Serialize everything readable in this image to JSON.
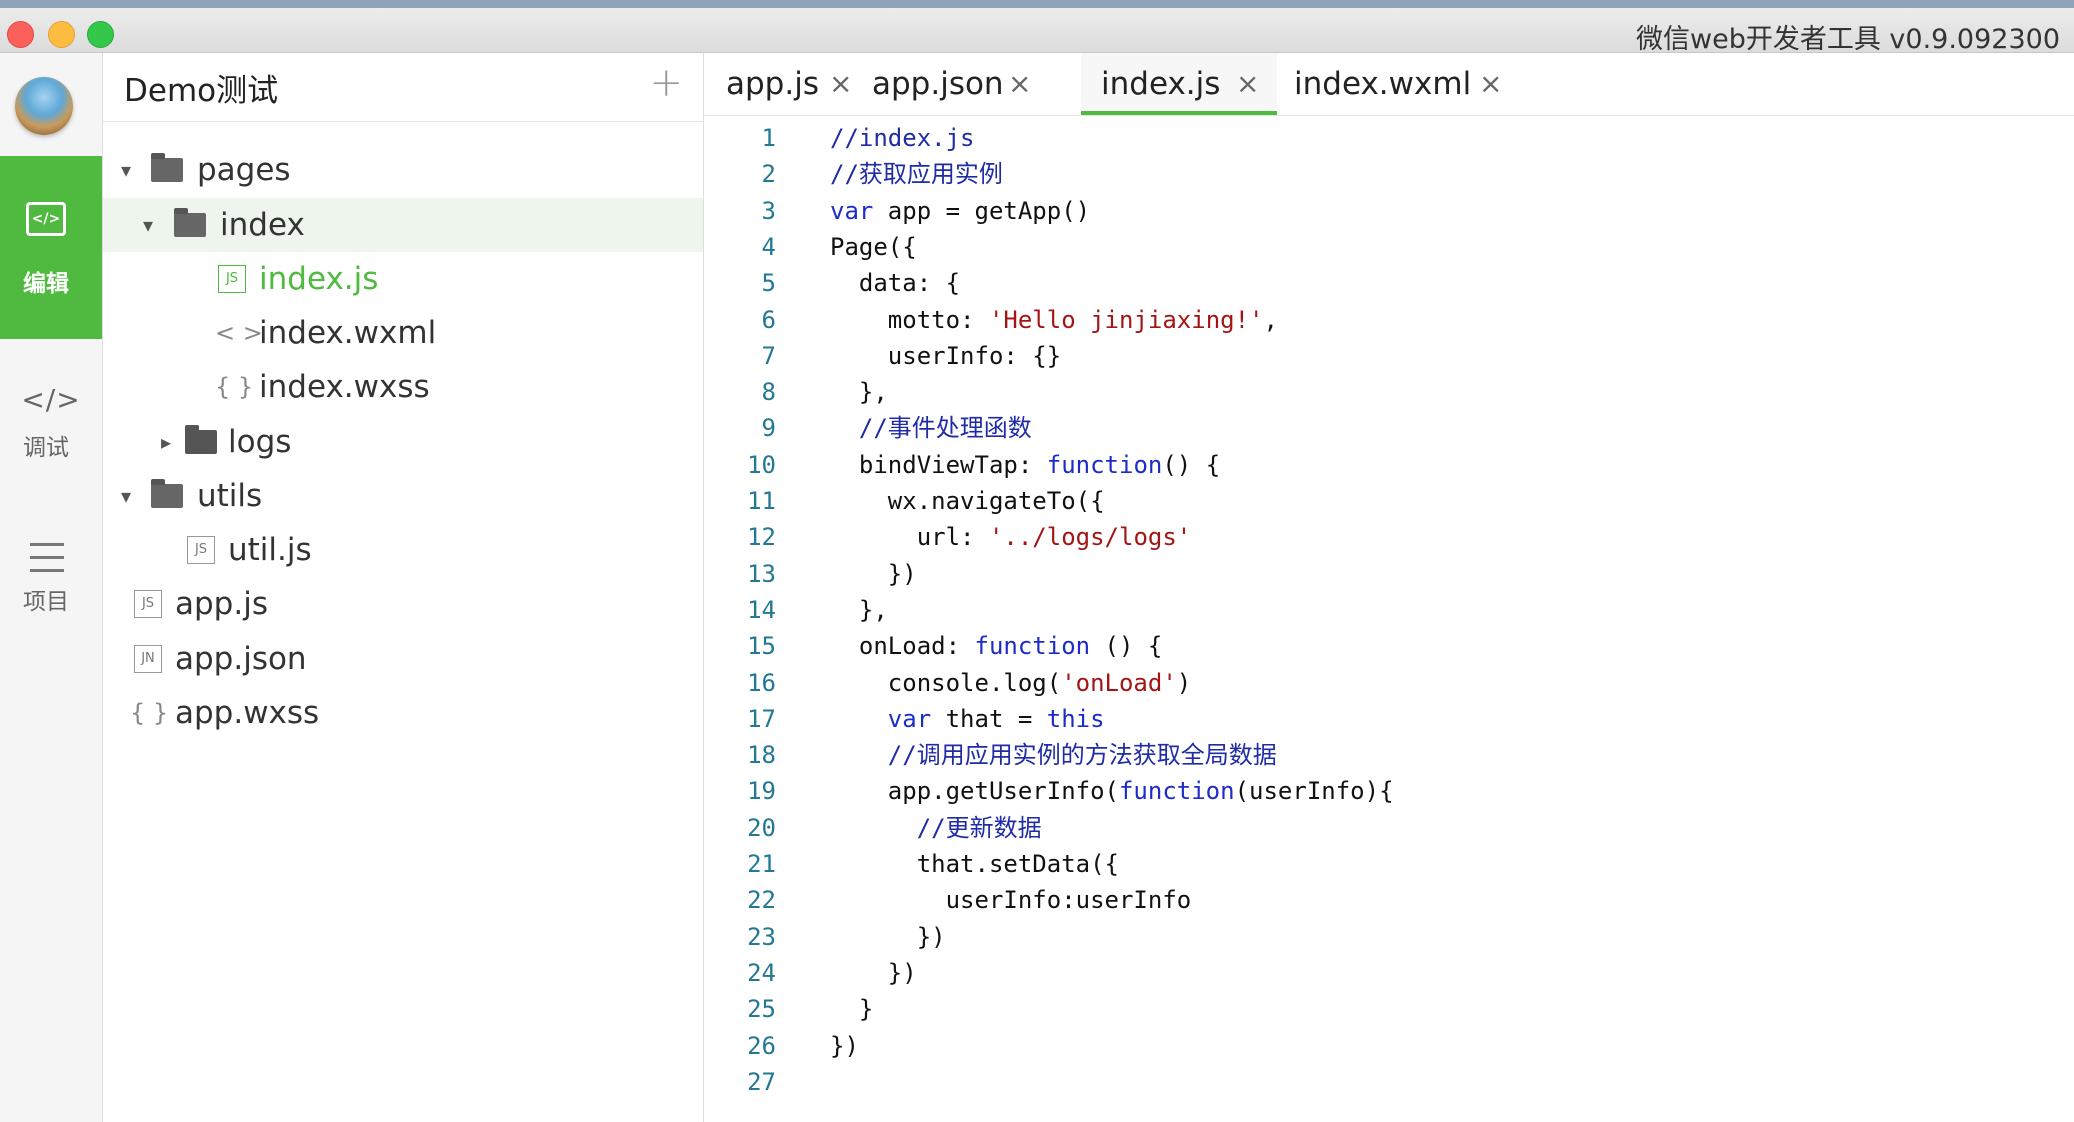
{
  "window": {
    "title": "微信web开发者工具 v0.9.092300"
  },
  "activity_bar": {
    "items": [
      {
        "label": "编辑",
        "icon": "code-box-icon",
        "active": true
      },
      {
        "label": "调试",
        "icon": "code-brackets-icon",
        "glyph": "</>"
      },
      {
        "label": "项目",
        "icon": "menu-lines-icon"
      }
    ]
  },
  "explorer": {
    "project_name": "Demo测试",
    "add_label": "+",
    "tree": [
      {
        "label": "pages",
        "type": "folder",
        "expanded": true
      },
      {
        "label": "index",
        "type": "folder",
        "expanded": true
      },
      {
        "label": "index.js",
        "type": "file",
        "badge": "JS",
        "active": true
      },
      {
        "label": "index.wxml",
        "type": "file",
        "badge": "< >"
      },
      {
        "label": "index.wxss",
        "type": "file",
        "badge": "{ }"
      },
      {
        "label": "logs",
        "type": "folder",
        "expanded": false
      },
      {
        "label": "utils",
        "type": "folder",
        "expanded": true
      },
      {
        "label": "util.js",
        "type": "file",
        "badge": "JS"
      },
      {
        "label": "app.js",
        "type": "file",
        "badge": "JS"
      },
      {
        "label": "app.json",
        "type": "file",
        "badge": "JN"
      },
      {
        "label": "app.wxss",
        "type": "file",
        "badge": "{ }"
      }
    ]
  },
  "tabs": [
    {
      "label": "app.js",
      "close": "×"
    },
    {
      "label": "app.json",
      "close": "×"
    },
    {
      "label": "index.js",
      "close": "×",
      "active": true
    },
    {
      "label": "index.wxml",
      "close": "×"
    }
  ],
  "editor": {
    "lines": [
      {
        "n": "1",
        "text": "//index.js"
      },
      {
        "n": "2",
        "text": "//获取应用实例"
      },
      {
        "n": "3",
        "text": "var app = getApp()"
      },
      {
        "n": "4",
        "text": "Page({"
      },
      {
        "n": "5",
        "text": "  data: {"
      },
      {
        "n": "6",
        "text": "    motto: 'Hello jinjiaxing!',"
      },
      {
        "n": "7",
        "text": "    userInfo: {}"
      },
      {
        "n": "8",
        "text": "  },"
      },
      {
        "n": "9",
        "text": "  //事件处理函数"
      },
      {
        "n": "10",
        "text": "  bindViewTap: function() {"
      },
      {
        "n": "11",
        "text": "    wx.navigateTo({"
      },
      {
        "n": "12",
        "text": "      url: '../logs/logs'"
      },
      {
        "n": "13",
        "text": "    })"
      },
      {
        "n": "14",
        "text": "  },"
      },
      {
        "n": "15",
        "text": "  onLoad: function () {"
      },
      {
        "n": "16",
        "text": "    console.log('onLoad')"
      },
      {
        "n": "17",
        "text": "    var that = this"
      },
      {
        "n": "18",
        "text": "    //调用应用实例的方法获取全局数据"
      },
      {
        "n": "19",
        "text": "    app.getUserInfo(function(userInfo){"
      },
      {
        "n": "20",
        "text": "      //更新数据"
      },
      {
        "n": "21",
        "text": "      that.setData({"
      },
      {
        "n": "22",
        "text": "        userInfo:userInfo"
      },
      {
        "n": "23",
        "text": "      })"
      },
      {
        "n": "24",
        "text": "    })"
      },
      {
        "n": "25",
        "text": "  }"
      },
      {
        "n": "26",
        "text": "})"
      },
      {
        "n": "27",
        "text": ""
      }
    ]
  },
  "colors": {
    "accent": "#4fba3f",
    "line_numbers": "#237893",
    "keyword": "#1d2cc8",
    "string": "#a31515",
    "comment": "#1f2ca6"
  }
}
